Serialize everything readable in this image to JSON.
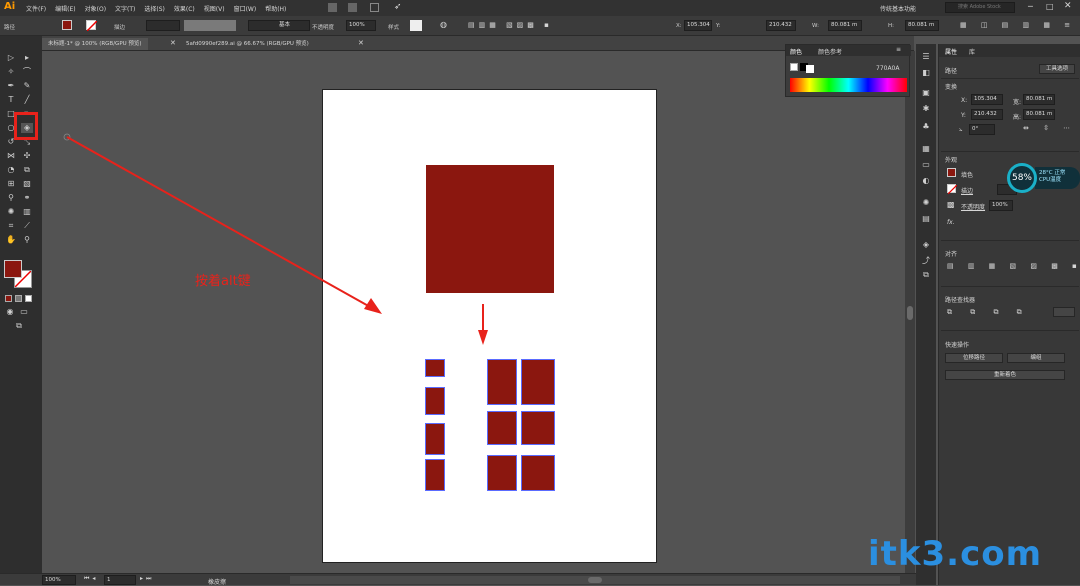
{
  "app": {
    "logo": "Ai"
  },
  "menu": [
    "文件(F)",
    "编辑(E)",
    "对象(O)",
    "文字(T)",
    "选择(S)",
    "效果(C)",
    "视图(V)",
    "窗口(W)",
    "帮助(H)"
  ],
  "workspace": "传统基本功能",
  "search_placeholder": "搜索 Adobe Stock",
  "control": {
    "path_label": "路径",
    "stroke_label": "描边",
    "stroke_style": "基本",
    "opacity_label": "不透明度",
    "opacity": "100%",
    "style_label": "样式",
    "x": "105.304",
    "y": "210.432",
    "w": "80.081 m",
    "h": "80.081 m"
  },
  "tabs": [
    "未标题-1* @ 100% (RGB/GPU 预览)",
    "5afd0990ef289.ai @ 66.67% (RGB/GPU 预览)"
  ],
  "color_panel": {
    "tab1": "颜色",
    "tab2": "颜色参考",
    "hex": "770A0A"
  },
  "props": {
    "tab1": "属性",
    "tab2": "库",
    "path": "路径",
    "tool_options": "工具选项",
    "transform": "变换",
    "x": "105.304",
    "y": "210.432",
    "w": "80.081 m",
    "h": "80.081 m",
    "angle": "0°",
    "appearance": "外观",
    "fill": "填色",
    "stroke": "描边",
    "opacity_label": "不透明度",
    "opacity": "100%",
    "fx": "fx.",
    "align": "对齐",
    "pathfinder": "路径查找器",
    "quick_actions": "快速操作",
    "offset_path": "位移路径",
    "group": "编组",
    "recolor": "重新着色"
  },
  "annotation": "按着alt键",
  "gauge": {
    "percent": "58%",
    "temp": "28°C 正常",
    "label": "CPU温度"
  },
  "status": {
    "zoom": "100%",
    "page": "1",
    "tool": "橡皮擦"
  },
  "watermark": "itk3.com",
  "colors": {
    "accent": "#8b170f",
    "annotation": "#e8221b",
    "selection": "#5a6bff"
  }
}
